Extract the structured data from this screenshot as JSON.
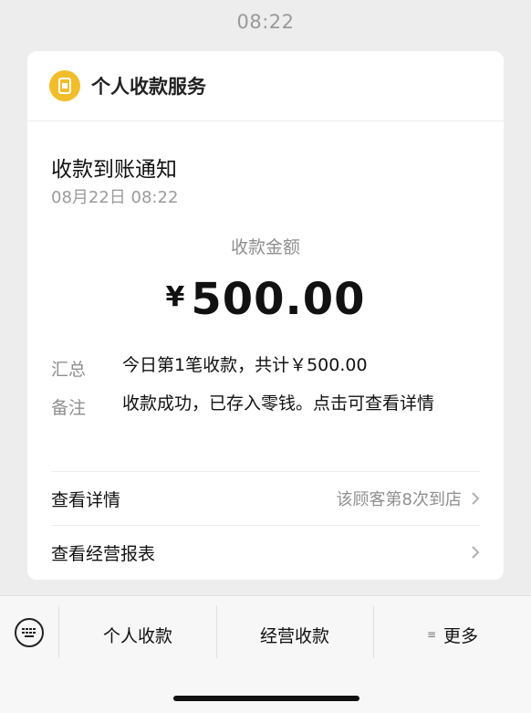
{
  "status_bar": {
    "time": "08:22"
  },
  "card": {
    "app_name": "个人收款服务",
    "notice_title": "收款到账通知",
    "notice_date": "08月22日 08:22",
    "amount_label": "收款金额",
    "currency_symbol": "¥",
    "amount_value": "500.00",
    "summary": {
      "key": "汇总",
      "value": "今日第1笔收款，共计￥500.00"
    },
    "remark": {
      "key": "备注",
      "value": "收款成功，已存入零钱。点击可查看详情"
    },
    "detail_link": {
      "label": "查看详情",
      "note": "该顾客第8次到店"
    },
    "report_link": {
      "label": "查看经营报表"
    }
  },
  "bottom_menu": {
    "items": [
      {
        "label": "个人收款"
      },
      {
        "label": "经营收款"
      },
      {
        "label": "更多"
      }
    ]
  },
  "colors": {
    "accent": "#f2bd2a",
    "background": "#ededed"
  },
  "icons": [
    "wallet-icon",
    "keyboard-icon",
    "chevron-right-icon",
    "menu-lines-icon"
  ]
}
